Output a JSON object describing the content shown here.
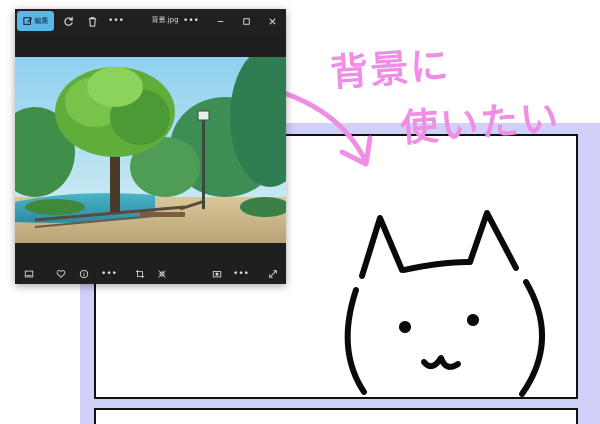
{
  "window": {
    "edit_label": "編集",
    "title": "背景.jpg",
    "more_glyph": "•••",
    "icons": [
      "edit-icon",
      "rotate-icon",
      "delete-icon",
      "more-icon",
      "minimize-icon",
      "maximize-icon",
      "close-icon"
    ]
  },
  "bottom_toolbar": {
    "icons": [
      "slideshow-icon",
      "favorite-icon",
      "info-icon",
      "more-icon",
      "crop-icon",
      "erase-icon",
      "camera-icon",
      "more-icon",
      "expand-icon"
    ],
    "more_glyph": "•••"
  },
  "annotation": {
    "line1": "背景に",
    "line2": "使いたい",
    "color": "#f08de4"
  },
  "colors": {
    "window_bg": "#1f1f1f",
    "accent": "#5ab8e8",
    "frame_lavender": "#d0d0f8"
  }
}
